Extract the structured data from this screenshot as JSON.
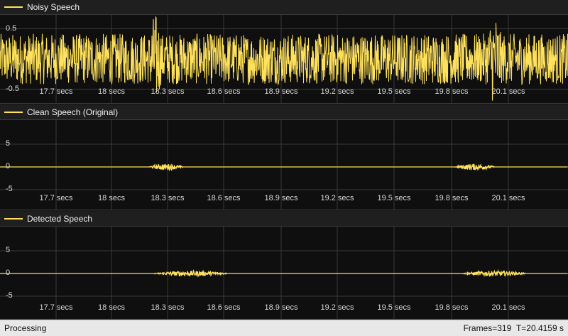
{
  "colors": {
    "trace": "#ffe15c",
    "plot_bg": "#0f0f0f",
    "grid": "#3a3a3a"
  },
  "status": {
    "left": "Processing",
    "frames": "Frames=319",
    "time": "T=20.4159 s"
  },
  "chart_data": [
    {
      "type": "line",
      "legend": "Noisy Speech",
      "x_ticks": [
        "17.7 secs",
        "18 secs",
        "18.3 secs",
        "18.6 secs",
        "18.9 secs",
        "19.2 secs",
        "19.5 secs",
        "19.8 secs",
        "20.1 secs"
      ],
      "y_ticks": [
        "0.5",
        "-0.5"
      ],
      "y_tick_values": [
        0.5,
        -0.5
      ],
      "ylim": [
        -0.8,
        0.8
      ],
      "xlim": [
        17.45,
        20.4159
      ],
      "grid": true,
      "bursts": [
        {
          "x_start": 17.45,
          "x_end": 20.4159,
          "amplitude": 0.42
        },
        {
          "x_start": 18.22,
          "x_end": 18.3,
          "amplitude": 0.75
        },
        {
          "x_start": 19.98,
          "x_end": 20.08,
          "amplitude": 0.75
        }
      ]
    },
    {
      "type": "line",
      "legend": "Clean Speech (Original)",
      "x_ticks": [
        "17.7 secs",
        "18 secs",
        "18.3 secs",
        "18.6 secs",
        "18.9 secs",
        "19.2 secs",
        "19.5 secs",
        "19.8 secs",
        "20.1 secs"
      ],
      "y_ticks": [
        "5",
        "0",
        "-5"
      ],
      "y_tick_values": [
        5,
        0,
        -5
      ],
      "ylim": [
        -9,
        9
      ],
      "xlim": [
        17.45,
        20.4159
      ],
      "grid": true,
      "bursts": [
        {
          "x_start": 18.23,
          "x_end": 18.4,
          "amplitude": 0.7
        },
        {
          "x_start": 19.83,
          "x_end": 20.03,
          "amplitude": 0.7
        }
      ]
    },
    {
      "type": "line",
      "legend": "Detected Speech",
      "x_ticks": [
        "17.7 secs",
        "18 secs",
        "18.3 secs",
        "18.6 secs",
        "18.9 secs",
        "19.2 secs",
        "19.5 secs",
        "19.8 secs",
        "20.1 secs"
      ],
      "y_ticks": [
        "5",
        "0",
        "-5"
      ],
      "y_tick_values": [
        5,
        0,
        -5
      ],
      "ylim": [
        -9,
        9
      ],
      "xlim": [
        17.45,
        20.4159
      ],
      "grid": true,
      "bursts": [
        {
          "x_start": 18.26,
          "x_end": 18.63,
          "amplitude": 0.6
        },
        {
          "x_start": 19.87,
          "x_end": 20.19,
          "amplitude": 0.6
        }
      ]
    }
  ]
}
